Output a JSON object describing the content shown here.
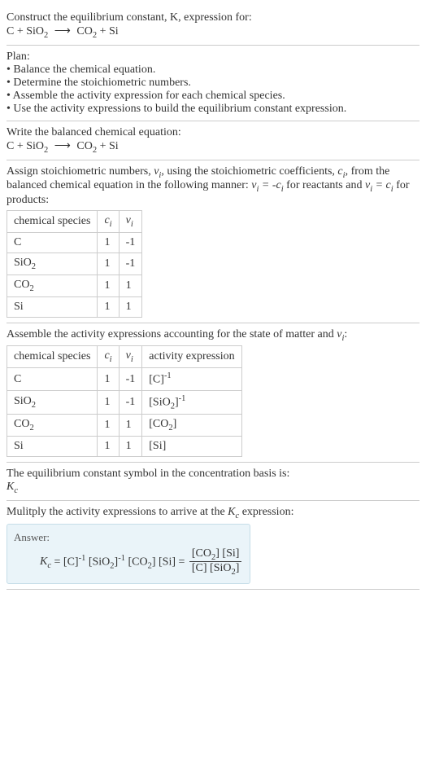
{
  "prompt": {
    "line1": "Construct the equilibrium constant, K, expression for:",
    "equation_lhs1": "C + SiO",
    "equation_rhs1": "CO",
    "equation_rhs2": " + Si"
  },
  "plan": {
    "header": "Plan:",
    "item1": "• Balance the chemical equation.",
    "item2": "• Determine the stoichiometric numbers.",
    "item3": "• Assemble the activity expression for each chemical species.",
    "item4": "• Use the activity expressions to build the equilibrium constant expression."
  },
  "balance": {
    "header": "Write the balanced chemical equation:"
  },
  "stoich": {
    "text1": "Assign stoichiometric numbers, ",
    "text2": ", using the stoichiometric coefficients, ",
    "text3": ", from the balanced chemical equation in the following manner: ",
    "text4": " for reactants and ",
    "text5": " for products:",
    "th1": "chemical species",
    "th2": "c",
    "th3": "ν",
    "rows": [
      {
        "species": "C",
        "c": "1",
        "v": "-1"
      },
      {
        "species": "SiO",
        "c": "1",
        "v": "-1"
      },
      {
        "species": "CO",
        "c": "1",
        "v": "1"
      },
      {
        "species": "Si",
        "c": "1",
        "v": "1"
      }
    ]
  },
  "activity": {
    "header": "Assemble the activity expressions accounting for the state of matter and ",
    "th1": "chemical species",
    "th2": "c",
    "th3": "ν",
    "th4": "activity expression",
    "rows": [
      {
        "species": "C",
        "c": "1",
        "v": "-1",
        "expr_base": "[C]",
        "expr_exp": "-1"
      },
      {
        "species": "SiO",
        "c": "1",
        "v": "-1",
        "expr_base": "[SiO",
        "expr_exp": "-1"
      },
      {
        "species": "CO",
        "c": "1",
        "v": "1",
        "expr_base": "[CO",
        "expr_exp": ""
      },
      {
        "species": "Si",
        "c": "1",
        "v": "1",
        "expr_base": "[Si]",
        "expr_exp": ""
      }
    ]
  },
  "symbol": {
    "text": "The equilibrium constant symbol in the concentration basis is:",
    "kc": "K"
  },
  "multiply": {
    "text1": "Mulitply the activity expressions to arrive at the ",
    "text2": " expression:"
  },
  "answer": {
    "label": "Answer:",
    "num1": "[CO",
    "num2": "] [Si]",
    "den1": "[C] [SiO",
    "den2": "]"
  },
  "chart_data": {
    "type": "table",
    "title": "Stoichiometric and activity data",
    "tables": [
      {
        "columns": [
          "chemical species",
          "c_i",
          "ν_i"
        ],
        "rows": [
          [
            "C",
            1,
            -1
          ],
          [
            "SiO2",
            1,
            -1
          ],
          [
            "CO2",
            1,
            1
          ],
          [
            "Si",
            1,
            1
          ]
        ]
      },
      {
        "columns": [
          "chemical species",
          "c_i",
          "ν_i",
          "activity expression"
        ],
        "rows": [
          [
            "C",
            1,
            -1,
            "[C]^-1"
          ],
          [
            "SiO2",
            1,
            -1,
            "[SiO2]^-1"
          ],
          [
            "CO2",
            1,
            1,
            "[CO2]"
          ],
          [
            "Si",
            1,
            1,
            "[Si]"
          ]
        ]
      }
    ]
  }
}
